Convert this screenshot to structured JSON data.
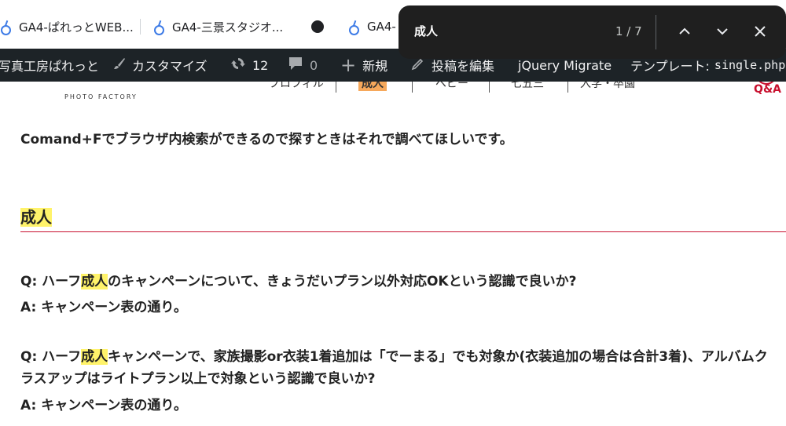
{
  "tabs": [
    {
      "title": "GA4-ぱれっとWEB...",
      "icon": "analytics-icon"
    },
    {
      "title": "GA4-三景スタジオ...",
      "icon": "analytics-icon"
    },
    {
      "title": "GA4-",
      "icon": "analytics-icon",
      "site_icon": "site-globe-icon"
    }
  ],
  "admin_bar": {
    "site_name": "写真工房ぱれっと",
    "customize": "カスタマイズ",
    "updates": "12",
    "comments": "0",
    "new": "新規",
    "edit_post": "投稿を編集",
    "jquery": "jQuery Migrate",
    "template_label": "テンプレート:",
    "template_file": "single.php"
  },
  "site_header": {
    "logo_sub": "PHOTO FACTORY",
    "nav": [
      "プロフィル",
      "成人",
      "ベビー",
      "七五三",
      "入学・卒園"
    ],
    "qa": "Q&A"
  },
  "content": {
    "intro": "Comand+Fでブラウザ内検索ができるので探すときはそれで調べてほしいです。",
    "section_title": "成人",
    "qa": [
      {
        "q_prefix": "Q: ハーフ",
        "q_hl": "成人",
        "q_rest": "のキャンペーンについて、きょうだいプラン以外対応OKという認識で良いか?",
        "a": "A: キャンペーン表の通り。"
      },
      {
        "q_prefix": "Q: ハーフ",
        "q_hl": "成人",
        "q_rest": "キャンペーンで、家族撮影or衣装1着追加は「でーまる」でも対象か(衣装追加の場合は合計3着)、アルバムク",
        "q_line2": "ラスアップはライトプラン以上で対象という認識で良いか?",
        "a": "A: キャンペーン表の通り。"
      }
    ]
  },
  "find": {
    "query": "成人",
    "count": "1 / 7"
  },
  "colors": {
    "highlight": "#fff36a",
    "rule": "#c8102e",
    "admin_bar": "#1d2327",
    "find_bg": "#1f1f1f"
  }
}
